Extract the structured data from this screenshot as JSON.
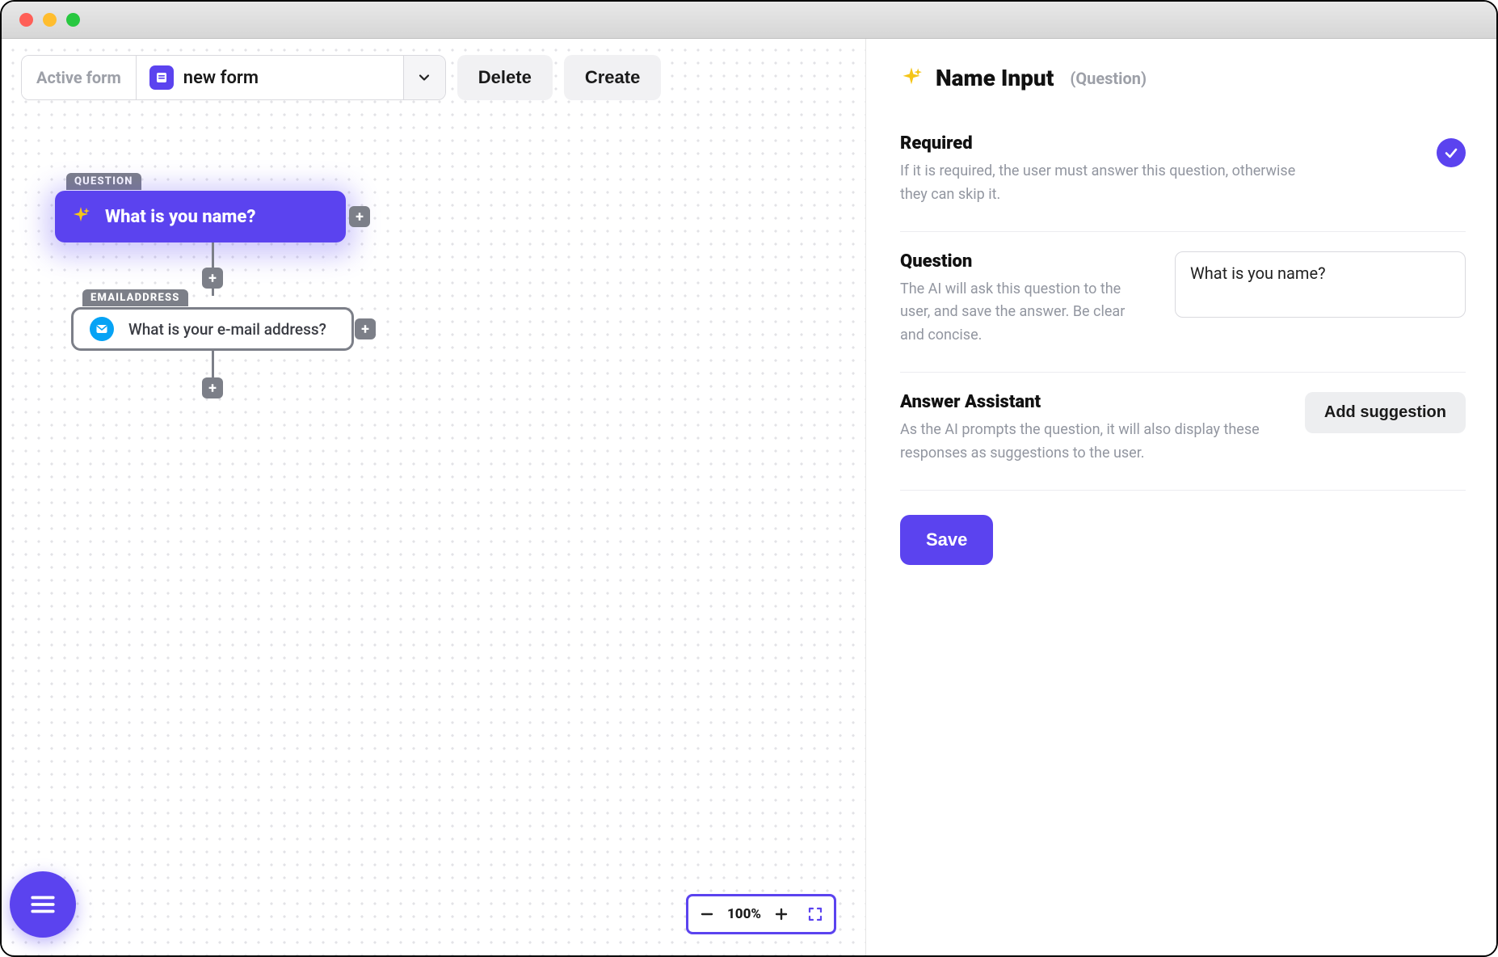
{
  "toolbar": {
    "active_form_label": "Active form",
    "form_name": "new form",
    "delete_label": "Delete",
    "create_label": "Create"
  },
  "canvas": {
    "nodes": [
      {
        "tag": "QUESTION",
        "text": "What is you name?"
      },
      {
        "tag": "EMAILADDRESS",
        "text": "What is your e-mail address?"
      }
    ],
    "zoom_level": "100%"
  },
  "panel": {
    "title": "Name Input",
    "subtitle": "(Question)",
    "required": {
      "heading": "Required",
      "description": "If it is required, the user must answer this question, otherwise they can skip it.",
      "checked": true
    },
    "question": {
      "heading": "Question",
      "description": "The AI will ask this question to the user, and save the answer. Be clear and concise.",
      "value": "What is you name?"
    },
    "answer_assistant": {
      "heading": "Answer Assistant",
      "description": "As the AI prompts the question, it will also display these responses as suggestions to the user.",
      "add_label": "Add suggestion"
    },
    "save_label": "Save"
  }
}
